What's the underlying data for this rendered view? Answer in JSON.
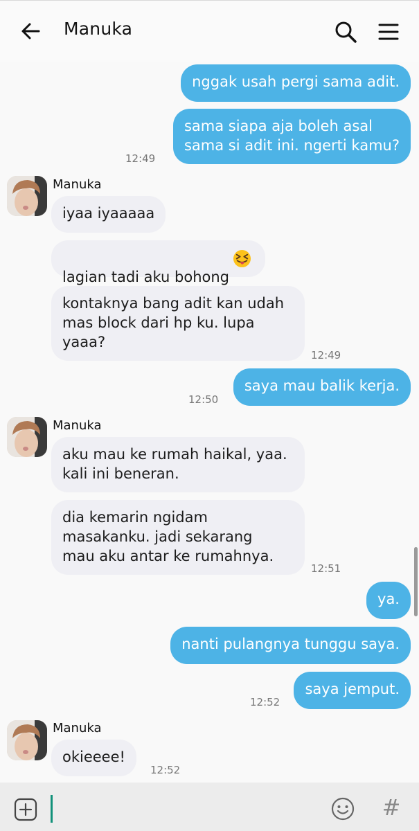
{
  "header": {
    "title": "Manuka"
  },
  "messages": [
    {
      "text": "nggak usah pergi sama adit."
    },
    {
      "text": "sama siapa aja boleh asal\nsama si adit ini. ngerti kamu?",
      "time": "12:49"
    },
    {
      "sender": "Manuka"
    },
    {
      "text": "iyaa iyaaaaa"
    },
    {
      "text": "lagian tadi aku bohong"
    },
    {
      "text": "kontaknya bang adit kan udah\nmas block dari hp ku. lupa\nyaaa?",
      "time": "12:49"
    },
    {
      "text": "saya mau balik kerja.",
      "time": "12:50"
    },
    {
      "sender": "Manuka"
    },
    {
      "text": "aku mau ke rumah haikal, yaa.\nkali ini beneran."
    },
    {
      "text": "dia kemarin ngidam\nmasakanku. jadi sekarang\nmau aku antar ke rumahnya.",
      "time": "12:51"
    },
    {
      "text": "ya."
    },
    {
      "text": "nanti pulangnya tunggu saya."
    },
    {
      "text": "saya jemput.",
      "time": "12:52"
    },
    {
      "sender": "Manuka"
    },
    {
      "text": "okieeee!",
      "time": "12:52"
    }
  ],
  "input": {
    "placeholder": ""
  },
  "colors": {
    "outgoing": "#4db3e6",
    "incoming": "#efeff4",
    "caret": "#12917a"
  },
  "icons": [
    "back-arrow-icon",
    "search-icon",
    "menu-icon",
    "plus-icon",
    "emoji-icon",
    "hashtag-icon",
    "squinting-tongue-emoji-icon"
  ]
}
